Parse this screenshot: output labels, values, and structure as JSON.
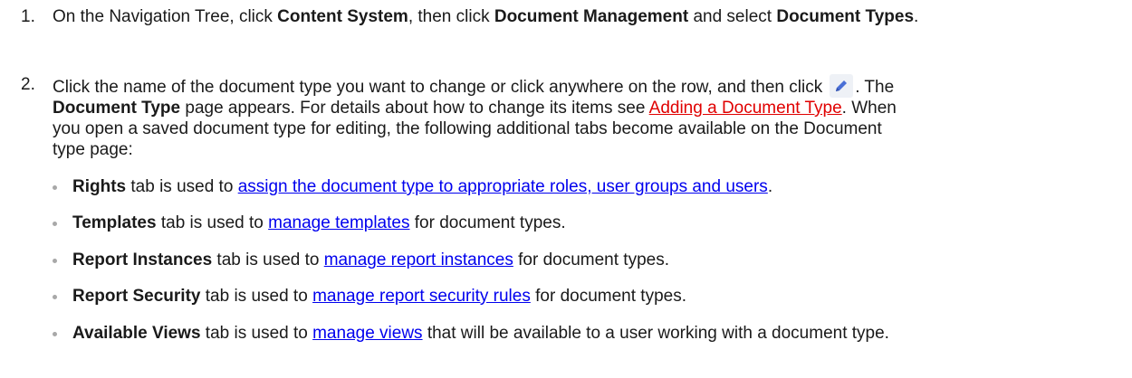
{
  "step1": {
    "number": "1.",
    "t1": "On the Navigation Tree, click ",
    "b1": "Content System",
    "t2": ", then click ",
    "b2": "Document Management",
    "t3": " and select ",
    "b3": "Document Types",
    "t4": "."
  },
  "step2": {
    "number": "2.",
    "t1": "Click the name of the document type you want to change or click anywhere on the row, and then click",
    "t2": ". The",
    "b1": "Document Type",
    "t3": " page appears. For details about how to change its items see ",
    "link": "Adding a Document Type",
    "t4": ". When",
    "line3": "you open a saved document type for editing, the following additional tabs become available on the Document",
    "line4": "type page:",
    "edit_icon": "pencil-icon"
  },
  "tabs": [
    {
      "name": "Rights",
      "text": " tab is used to ",
      "link": "assign the document type to appropriate roles, user groups and users",
      "tail": "."
    },
    {
      "name": "Templates",
      "text": " tab is used to ",
      "link": "manage templates",
      "tail": " for document types."
    },
    {
      "name": "Report Instances",
      "text": " tab is used to ",
      "link": "manage report instances",
      "tail": " for document types."
    },
    {
      "name": "Report Security",
      "text": " tab is used to ",
      "link": "manage report security rules",
      "tail": " for document types."
    },
    {
      "name": "Available Views",
      "text": " tab is used to ",
      "link": "manage views",
      "tail": " that will be available to a user working with a document type."
    }
  ]
}
